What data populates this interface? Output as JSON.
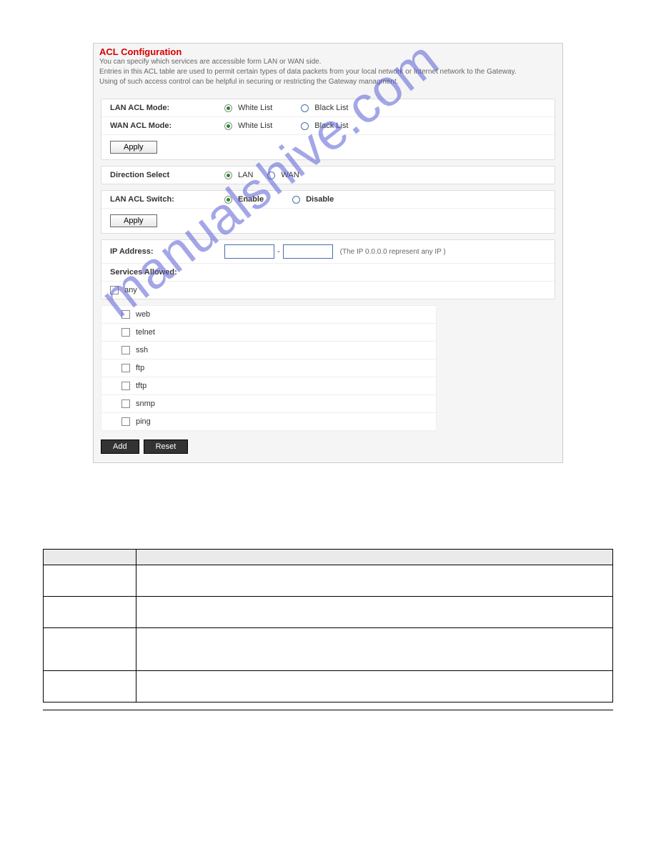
{
  "watermark": "manualshive.com",
  "panel": {
    "title": "ACL Configuration",
    "desc1": "You can specify which services are accessible form LAN or WAN side.",
    "desc2": "Entries in this ACL table are used to permit certain types of data packets from your local network or Internet network to the Gateway.",
    "desc3": "Using of such access control can be helpful in securing or restricting the Gateway managment."
  },
  "mode": {
    "lan_label": "LAN ACL Mode:",
    "wan_label": "WAN ACL Mode:",
    "white": "White List",
    "black": "Black List",
    "apply": "Apply"
  },
  "direction": {
    "label": "Direction Select",
    "lan": "LAN",
    "wan": "WAN"
  },
  "switch": {
    "label": "LAN ACL Switch:",
    "enable": "Enable",
    "disable": "Disable",
    "apply": "Apply"
  },
  "ip": {
    "label": "IP Address:",
    "hint": "(The IP 0.0.0.0 represent any IP )"
  },
  "services": {
    "label": "Services Allowed:",
    "any": "any",
    "list": [
      "web",
      "telnet",
      "ssh",
      "ftp",
      "tftp",
      "snmp",
      "ping"
    ]
  },
  "actions": {
    "add": "Add",
    "reset": "Reset"
  }
}
